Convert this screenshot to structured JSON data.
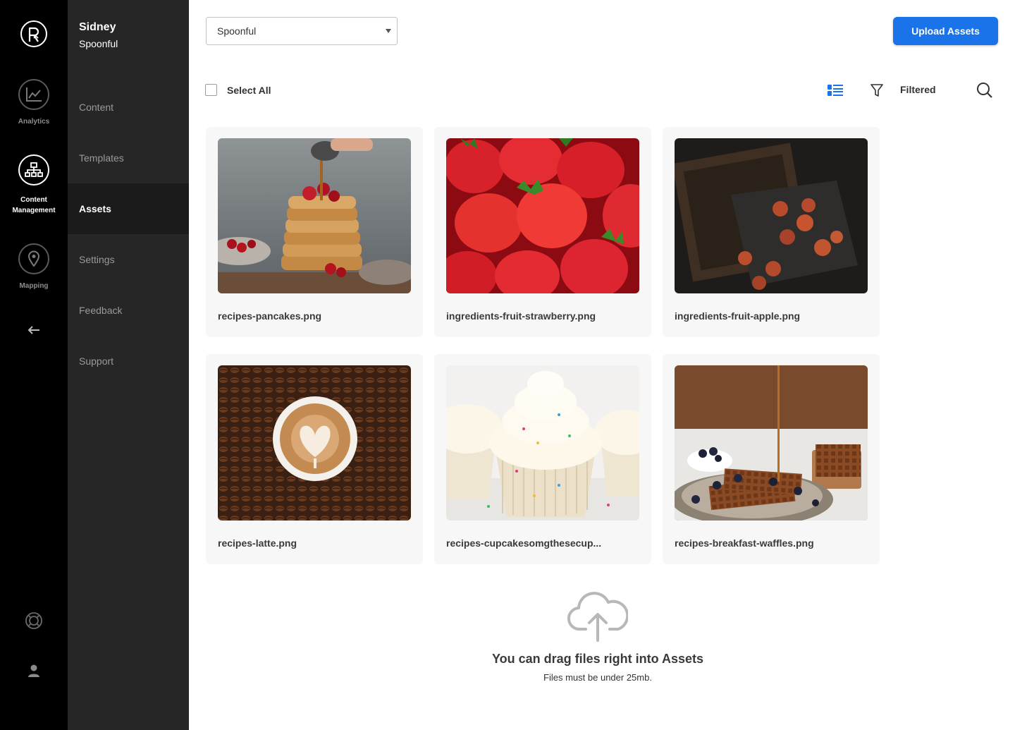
{
  "rail": {
    "logo": "brand-logo",
    "items": [
      {
        "name": "analytics",
        "label": "Analytics",
        "icon": "chart-icon",
        "active": false
      },
      {
        "name": "content-management",
        "label": "Content Management",
        "icon": "sitemap-icon",
        "active": true
      },
      {
        "name": "mapping",
        "label": "Mapping",
        "icon": "map-pin-icon",
        "active": false
      }
    ],
    "back_icon": "arrow-left-icon",
    "help_icon": "lifebuoy-icon",
    "account_icon": "user-icon"
  },
  "sidebar": {
    "user_name": "Sidney",
    "org_name": "Spoonful",
    "items": [
      {
        "label": "Content",
        "active": false
      },
      {
        "label": "Templates",
        "active": false
      },
      {
        "label": "Assets",
        "active": true
      },
      {
        "label": "Settings",
        "active": false
      },
      {
        "label": "Feedback",
        "active": false
      },
      {
        "label": "Support",
        "active": false
      }
    ]
  },
  "toolbar": {
    "org_select_value": "Spoonful",
    "upload_label": "Upload Assets",
    "select_all_label": "Select All",
    "filter_label": "Filtered"
  },
  "assets": [
    {
      "file_name": "recipes-pancakes.png"
    },
    {
      "file_name": "ingredients-fruit-strawberry.png"
    },
    {
      "file_name": "ingredients-fruit-apple.png"
    },
    {
      "file_name": "recipes-latte.png"
    },
    {
      "file_name": "recipes-cupcakesomgthesecup..."
    },
    {
      "file_name": "recipes-breakfast-waffles.png"
    }
  ],
  "dropzone": {
    "title": "You can drag files right into Assets",
    "subtitle": "Files must be under 25mb."
  },
  "colors": {
    "accent": "#1a73e8",
    "rail_bg": "#000000",
    "sidebar_bg": "#262626",
    "card_bg": "#f7f7f7"
  }
}
